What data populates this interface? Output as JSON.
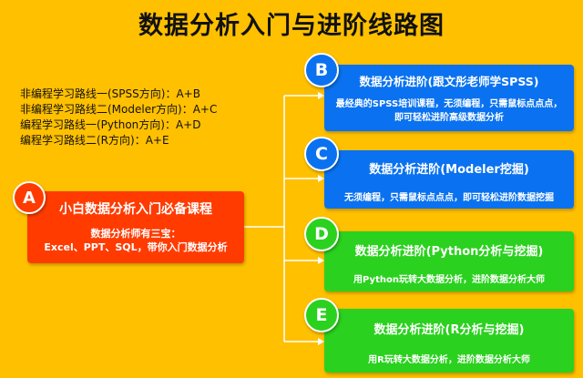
{
  "title": "数据分析入门与进阶线路图",
  "routes": [
    "非编程学习路线一(SPSS方向)：A+B",
    "非编程学习路线二(Modeler方向)：A+C",
    "编程学习路线一(Python方向)：A+D",
    "编程学习路线二(R方向)：A+E"
  ],
  "nodes": {
    "a": {
      "letter": "A",
      "title": "小白数据分析入门必备课程",
      "desc_line1": "数据分析师有三宝：",
      "desc_line2": "Excel、PPT、SQL，带你入门数据分析",
      "color": "#FF3B00"
    },
    "b": {
      "letter": "B",
      "title": "数据分析进阶(跟文彤老师学SPSS)",
      "desc_line1": "最经典的SPSS培训课程，无须编程，只需鼠标点点点，",
      "desc_line2": "即可轻松进阶高级数据分析",
      "color": "#0A72F0"
    },
    "c": {
      "letter": "C",
      "title": "数据分析进阶(Modeler挖掘)",
      "desc": "无须编程，只需鼠标点点点，即可轻松进阶数据挖掘",
      "color": "#0A72F0"
    },
    "d": {
      "letter": "D",
      "title": "数据分析进阶(Python分析与挖掘)",
      "desc": "用Python玩转大数据分析，进阶数据分析大师",
      "color": "#2BD11F"
    },
    "e": {
      "letter": "E",
      "title": "数据分析进阶(R分析与挖掘)",
      "desc": "用R玩转大数据分析，进阶数据分析大师",
      "color": "#2BD11F"
    }
  }
}
